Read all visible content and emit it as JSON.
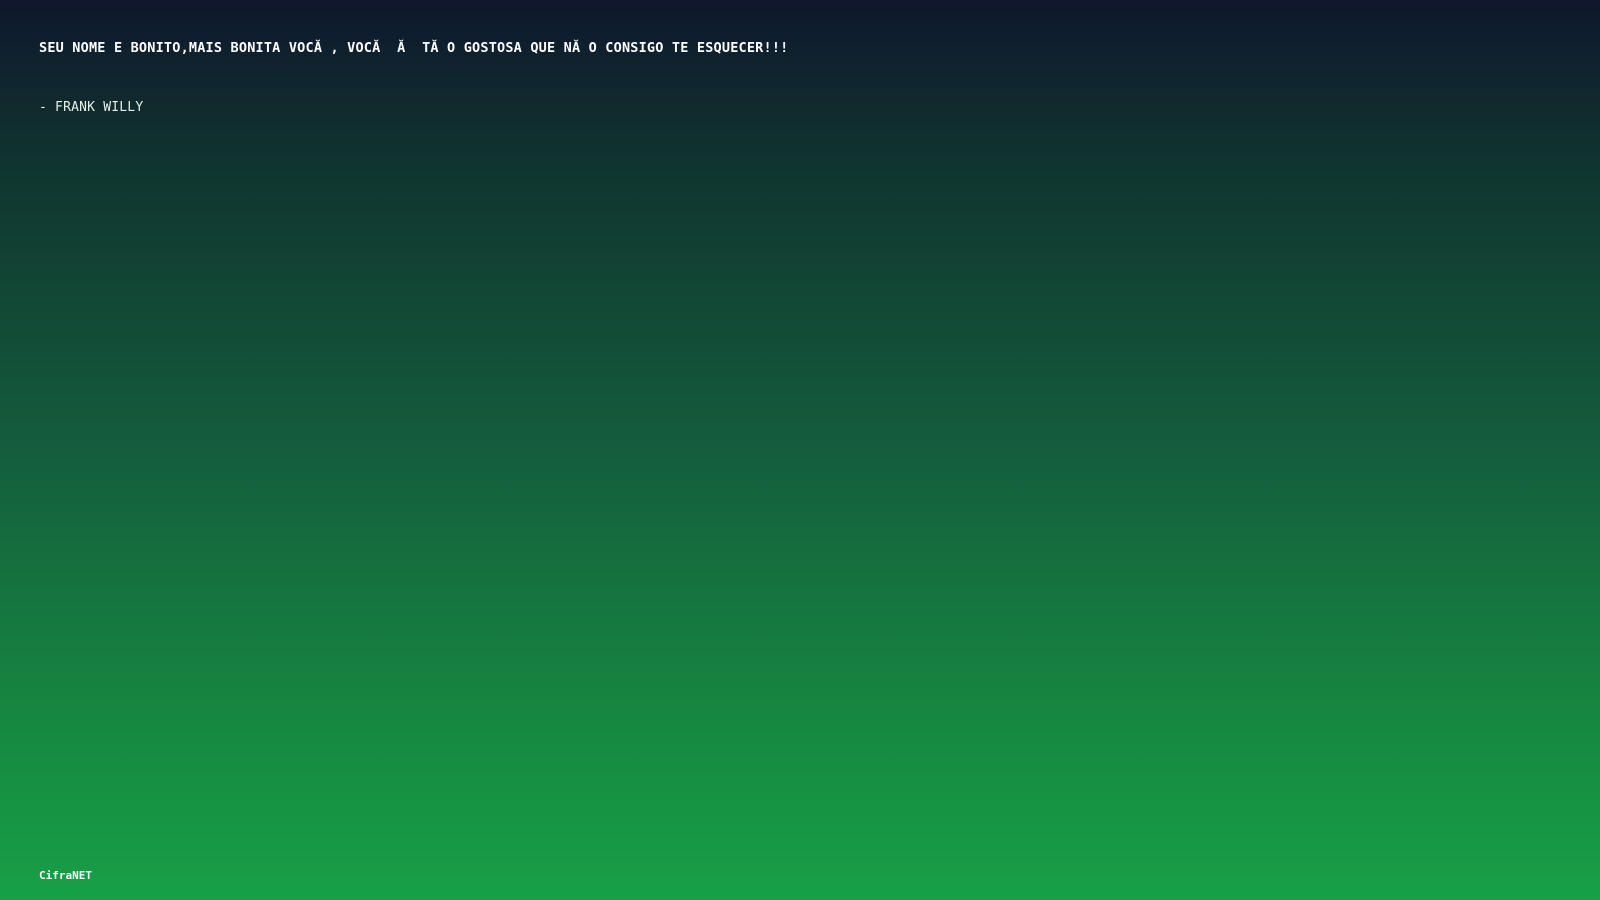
{
  "quote": {
    "text": "SEU NOME E BONITO,MAIS BONITA VOCĂ , VOCĂ  Ă  TĂ O GOSTOSA QUE NĂ O CONSIGO TE ESQUECER!!!",
    "author": "- FRANK WILLY"
  },
  "footer": {
    "brand": "CifraNET"
  },
  "colors": {
    "background_top": "#0f172d",
    "background_bottom": "#17a046",
    "text": "#ffffff"
  }
}
